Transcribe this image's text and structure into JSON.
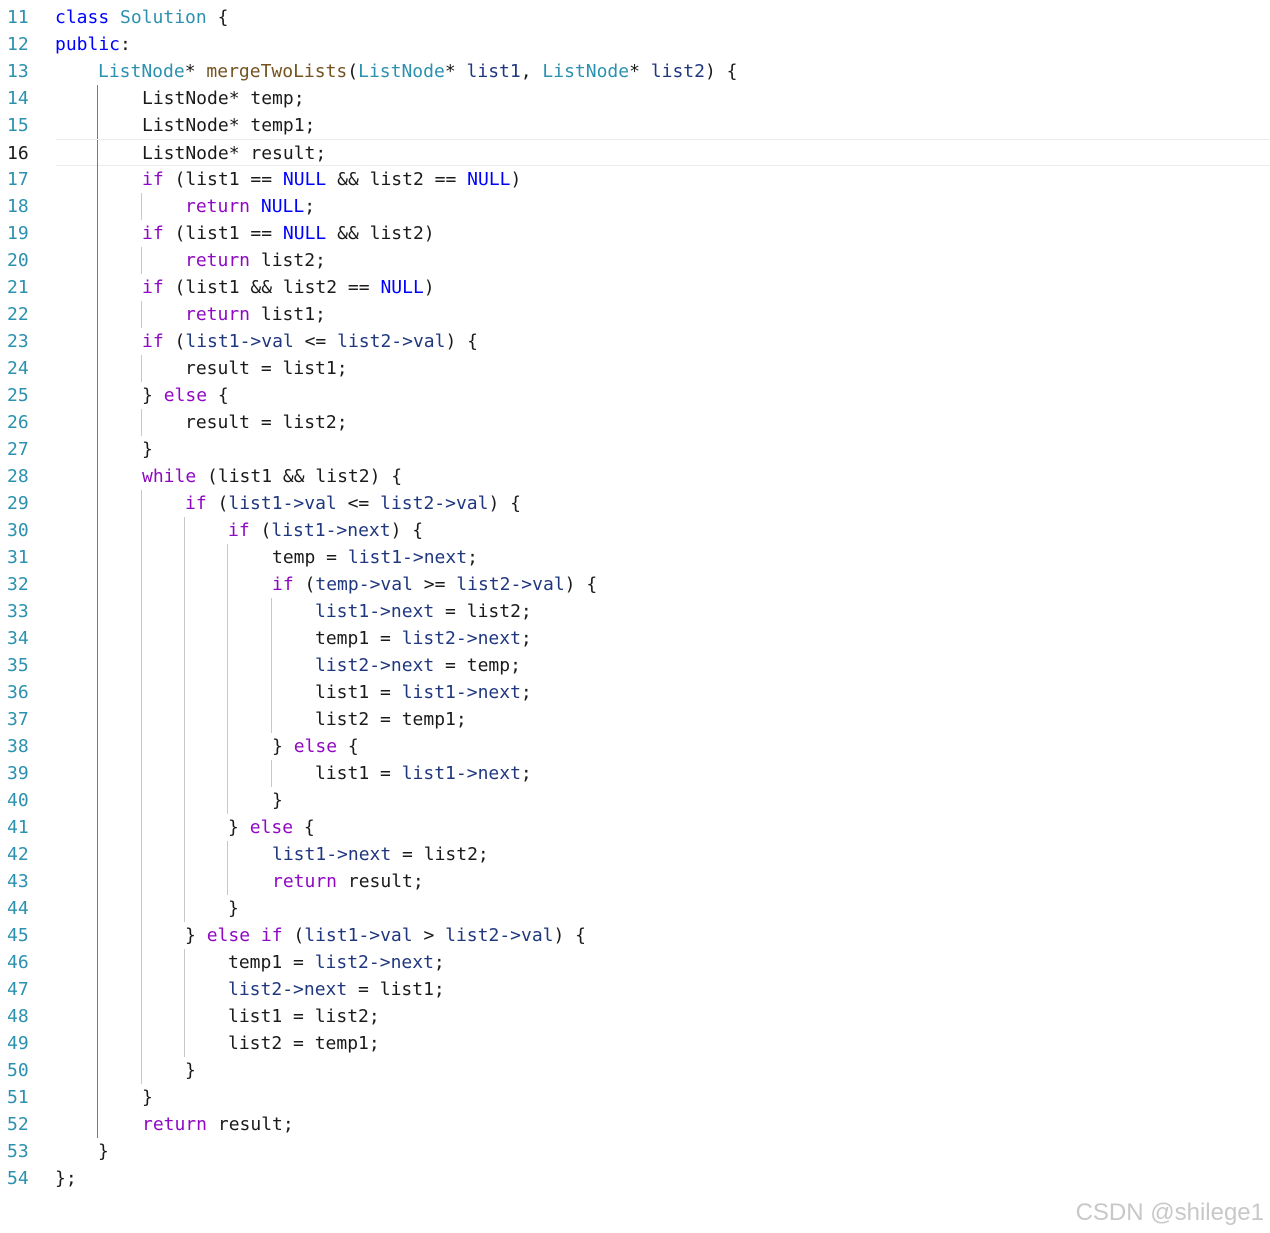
{
  "editor": {
    "current_line": 16,
    "lines": [
      {
        "n": "11",
        "indent": 0,
        "tokens": [
          [
            "kw",
            "class"
          ],
          [
            "",
            " "
          ],
          [
            "type",
            "Solution"
          ],
          [
            "",
            " {"
          ]
        ]
      },
      {
        "n": "12",
        "indent": 0,
        "tokens": [
          [
            "kw",
            "public"
          ],
          [
            "",
            ":"
          ]
        ]
      },
      {
        "n": "13",
        "indent": 1,
        "tokens": [
          [
            "type",
            "ListNode"
          ],
          [
            "",
            "* "
          ],
          [
            "fn",
            "mergeTwoLists"
          ],
          [
            "",
            "("
          ],
          [
            "type",
            "ListNode"
          ],
          [
            "",
            "* "
          ],
          [
            "var",
            "list1"
          ],
          [
            "",
            ", "
          ],
          [
            "type",
            "ListNode"
          ],
          [
            "",
            "* "
          ],
          [
            "var",
            "list2"
          ],
          [
            "",
            ") {"
          ]
        ]
      },
      {
        "n": "14",
        "indent": 2,
        "tokens": [
          [
            "",
            "ListNode* temp;"
          ]
        ]
      },
      {
        "n": "15",
        "indent": 2,
        "tokens": [
          [
            "",
            "ListNode* temp1;"
          ]
        ]
      },
      {
        "n": "16",
        "indent": 2,
        "tokens": [
          [
            "",
            "ListNode* result;"
          ]
        ]
      },
      {
        "n": "17",
        "indent": 2,
        "tokens": [
          [
            "kw2",
            "if"
          ],
          [
            "",
            " (list1 == "
          ],
          [
            "mac",
            "NULL"
          ],
          [
            "",
            " && list2 == "
          ],
          [
            "mac",
            "NULL"
          ],
          [
            "",
            ")"
          ]
        ]
      },
      {
        "n": "18",
        "indent": 3,
        "tokens": [
          [
            "kw2",
            "return"
          ],
          [
            "",
            " "
          ],
          [
            "mac",
            "NULL"
          ],
          [
            "",
            ";"
          ]
        ]
      },
      {
        "n": "19",
        "indent": 2,
        "tokens": [
          [
            "kw2",
            "if"
          ],
          [
            "",
            " (list1 == "
          ],
          [
            "mac",
            "NULL"
          ],
          [
            "",
            " && list2)"
          ]
        ]
      },
      {
        "n": "20",
        "indent": 3,
        "tokens": [
          [
            "kw2",
            "return"
          ],
          [
            "",
            " list2;"
          ]
        ]
      },
      {
        "n": "21",
        "indent": 2,
        "tokens": [
          [
            "kw2",
            "if"
          ],
          [
            "",
            " (list1 && list2 == "
          ],
          [
            "mac",
            "NULL"
          ],
          [
            "",
            ")"
          ]
        ]
      },
      {
        "n": "22",
        "indent": 3,
        "tokens": [
          [
            "kw2",
            "return"
          ],
          [
            "",
            " list1;"
          ]
        ]
      },
      {
        "n": "23",
        "indent": 2,
        "tokens": [
          [
            "kw2",
            "if"
          ],
          [
            "",
            " ("
          ],
          [
            "var",
            "list1"
          ],
          [
            "mem",
            "->val"
          ],
          [
            "",
            " <= "
          ],
          [
            "var",
            "list2"
          ],
          [
            "mem",
            "->val"
          ],
          [
            "",
            ") {"
          ]
        ]
      },
      {
        "n": "24",
        "indent": 3,
        "tokens": [
          [
            "",
            "result = list1;"
          ]
        ]
      },
      {
        "n": "25",
        "indent": 2,
        "tokens": [
          [
            "",
            "} "
          ],
          [
            "kw2",
            "else"
          ],
          [
            "",
            " {"
          ]
        ]
      },
      {
        "n": "26",
        "indent": 3,
        "tokens": [
          [
            "",
            "result = list2;"
          ]
        ]
      },
      {
        "n": "27",
        "indent": 2,
        "tokens": [
          [
            "",
            "}"
          ]
        ]
      },
      {
        "n": "28",
        "indent": 2,
        "tokens": [
          [
            "kw2",
            "while"
          ],
          [
            "",
            " (list1 && list2) {"
          ]
        ]
      },
      {
        "n": "29",
        "indent": 3,
        "tokens": [
          [
            "kw2",
            "if"
          ],
          [
            "",
            " ("
          ],
          [
            "var",
            "list1"
          ],
          [
            "mem",
            "->val"
          ],
          [
            "",
            " <= "
          ],
          [
            "var",
            "list2"
          ],
          [
            "mem",
            "->val"
          ],
          [
            "",
            ") {"
          ]
        ]
      },
      {
        "n": "30",
        "indent": 4,
        "tokens": [
          [
            "kw2",
            "if"
          ],
          [
            "",
            " ("
          ],
          [
            "var",
            "list1"
          ],
          [
            "mem",
            "->next"
          ],
          [
            "",
            ") {"
          ]
        ]
      },
      {
        "n": "31",
        "indent": 5,
        "tokens": [
          [
            "",
            "temp = "
          ],
          [
            "var",
            "list1"
          ],
          [
            "mem",
            "->next"
          ],
          [
            "",
            ";"
          ]
        ]
      },
      {
        "n": "32",
        "indent": 5,
        "tokens": [
          [
            "kw2",
            "if"
          ],
          [
            "",
            " ("
          ],
          [
            "var",
            "temp"
          ],
          [
            "mem",
            "->val"
          ],
          [
            "",
            " >= "
          ],
          [
            "var",
            "list2"
          ],
          [
            "mem",
            "->val"
          ],
          [
            "",
            ") {"
          ]
        ]
      },
      {
        "n": "33",
        "indent": 6,
        "tokens": [
          [
            "var",
            "list1"
          ],
          [
            "mem",
            "->next"
          ],
          [
            "",
            " = list2;"
          ]
        ]
      },
      {
        "n": "34",
        "indent": 6,
        "tokens": [
          [
            "",
            "temp1 = "
          ],
          [
            "var",
            "list2"
          ],
          [
            "mem",
            "->next"
          ],
          [
            "",
            ";"
          ]
        ]
      },
      {
        "n": "35",
        "indent": 6,
        "tokens": [
          [
            "var",
            "list2"
          ],
          [
            "mem",
            "->next"
          ],
          [
            "",
            " = temp;"
          ]
        ]
      },
      {
        "n": "36",
        "indent": 6,
        "tokens": [
          [
            "",
            "list1 = "
          ],
          [
            "var",
            "list1"
          ],
          [
            "mem",
            "->next"
          ],
          [
            "",
            ";"
          ]
        ]
      },
      {
        "n": "37",
        "indent": 6,
        "tokens": [
          [
            "",
            "list2 = temp1;"
          ]
        ]
      },
      {
        "n": "38",
        "indent": 5,
        "tokens": [
          [
            "",
            "} "
          ],
          [
            "kw2",
            "else"
          ],
          [
            "",
            " {"
          ]
        ]
      },
      {
        "n": "39",
        "indent": 6,
        "tokens": [
          [
            "",
            "list1 = "
          ],
          [
            "var",
            "list1"
          ],
          [
            "mem",
            "->next"
          ],
          [
            "",
            ";"
          ]
        ]
      },
      {
        "n": "40",
        "indent": 5,
        "tokens": [
          [
            "",
            "}"
          ]
        ]
      },
      {
        "n": "41",
        "indent": 4,
        "tokens": [
          [
            "",
            "} "
          ],
          [
            "kw2",
            "else"
          ],
          [
            "",
            " {"
          ]
        ]
      },
      {
        "n": "42",
        "indent": 5,
        "tokens": [
          [
            "var",
            "list1"
          ],
          [
            "mem",
            "->next"
          ],
          [
            "",
            " = list2;"
          ]
        ]
      },
      {
        "n": "43",
        "indent": 5,
        "tokens": [
          [
            "kw2",
            "return"
          ],
          [
            "",
            " result;"
          ]
        ]
      },
      {
        "n": "44",
        "indent": 4,
        "tokens": [
          [
            "",
            "}"
          ]
        ]
      },
      {
        "n": "45",
        "indent": 3,
        "tokens": [
          [
            "",
            "} "
          ],
          [
            "kw2",
            "else if"
          ],
          [
            "",
            " ("
          ],
          [
            "var",
            "list1"
          ],
          [
            "mem",
            "->val"
          ],
          [
            "",
            " > "
          ],
          [
            "var",
            "list2"
          ],
          [
            "mem",
            "->val"
          ],
          [
            "",
            ") {"
          ]
        ]
      },
      {
        "n": "46",
        "indent": 4,
        "tokens": [
          [
            "",
            "temp1 = "
          ],
          [
            "var",
            "list2"
          ],
          [
            "mem",
            "->next"
          ],
          [
            "",
            ";"
          ]
        ]
      },
      {
        "n": "47",
        "indent": 4,
        "tokens": [
          [
            "var",
            "list2"
          ],
          [
            "mem",
            "->next"
          ],
          [
            "",
            " = list1;"
          ]
        ]
      },
      {
        "n": "48",
        "indent": 4,
        "tokens": [
          [
            "",
            "list1 = list2;"
          ]
        ]
      },
      {
        "n": "49",
        "indent": 4,
        "tokens": [
          [
            "",
            "list2 = temp1;"
          ]
        ]
      },
      {
        "n": "50",
        "indent": 3,
        "tokens": [
          [
            "",
            "}"
          ]
        ]
      },
      {
        "n": "51",
        "indent": 2,
        "tokens": [
          [
            "",
            "}"
          ]
        ]
      },
      {
        "n": "52",
        "indent": 2,
        "tokens": [
          [
            "kw2",
            "return"
          ],
          [
            "",
            " result;"
          ]
        ]
      },
      {
        "n": "53",
        "indent": 1,
        "tokens": [
          [
            "",
            "}"
          ]
        ]
      },
      {
        "n": "54",
        "indent": 0,
        "tokens": [
          [
            "",
            "};"
          ]
        ]
      }
    ]
  },
  "watermark": "CSDN @shilege1"
}
